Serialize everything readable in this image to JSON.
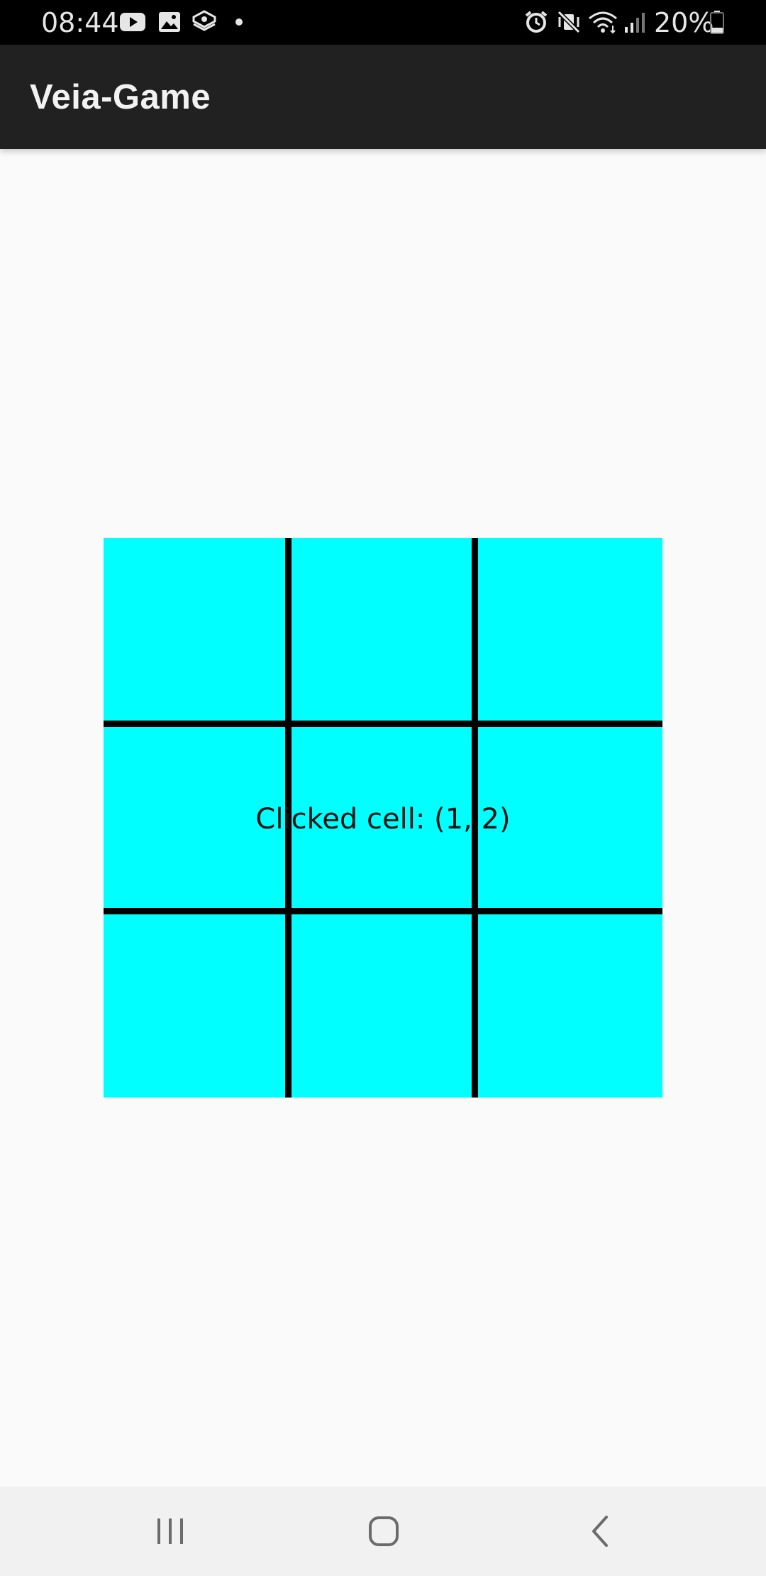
{
  "status_bar": {
    "time": "08:44",
    "battery": "20%",
    "icons": [
      "youtube-icon",
      "gallery-icon",
      "app-notification-icon",
      "dot-icon",
      "alarm-icon",
      "vibrate-mute-icon",
      "wifi-icon",
      "signal-icon",
      "battery-icon"
    ]
  },
  "app_bar": {
    "title": "Veia-Game"
  },
  "board": {
    "rows": 3,
    "cols": 3,
    "cell_color": "#00ffff",
    "line_color": "#000000",
    "status_text": "Clicked cell: (1, 2)"
  },
  "nav_bar": {
    "buttons": [
      "recents-icon",
      "home-icon",
      "back-icon"
    ]
  }
}
